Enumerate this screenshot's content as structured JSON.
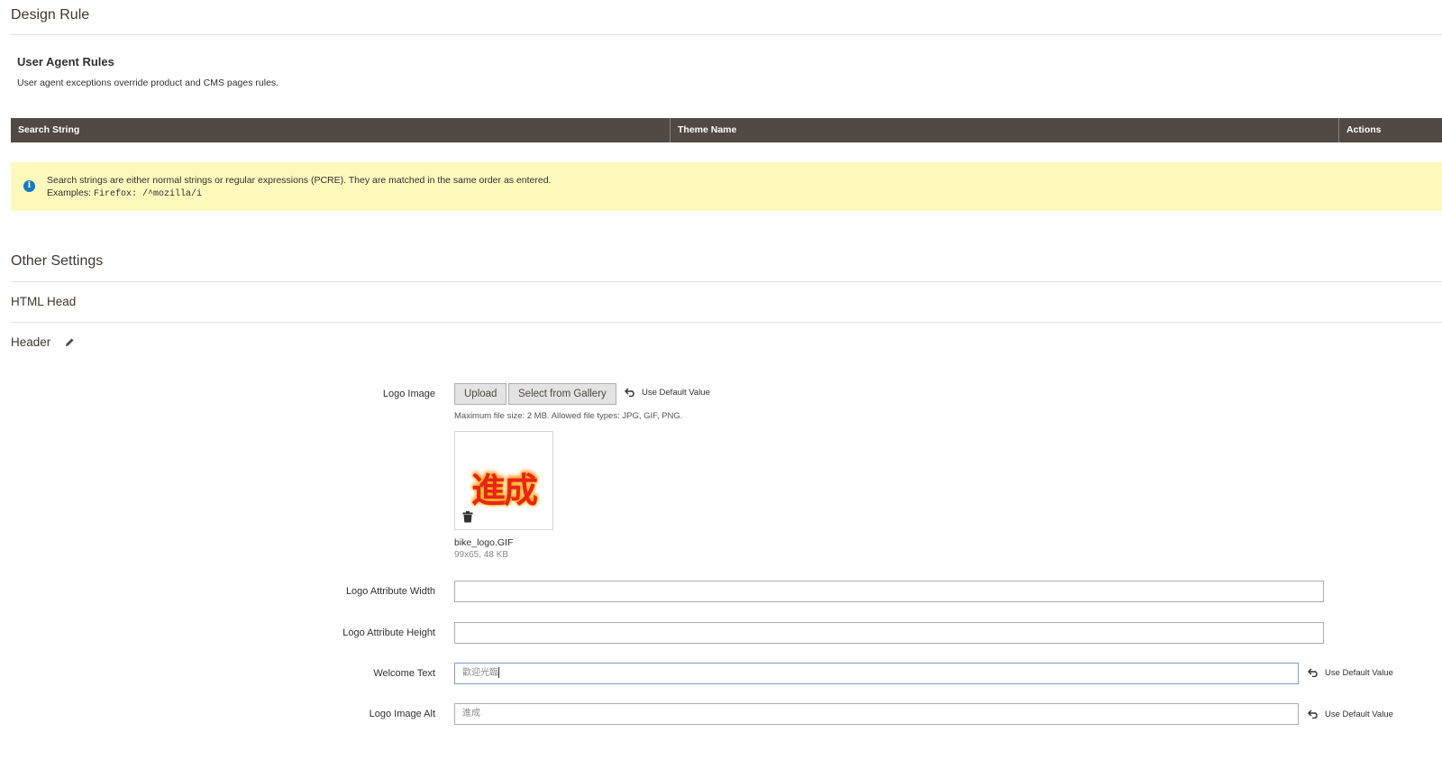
{
  "design_rule": {
    "title": "Design Rule"
  },
  "user_agent": {
    "title": "User Agent Rules",
    "description": "User agent exceptions override product and CMS pages rules.",
    "columns": [
      "Search String",
      "Theme Name",
      "Actions"
    ],
    "notice_line1": "Search strings are either normal strings or regular expressions (PCRE). They are matched in the same order as entered.",
    "notice_examples_label": "Examples:",
    "notice_examples_code": "Firefox: /^mozilla/i"
  },
  "other_settings": {
    "title": "Other Settings",
    "html_head": "HTML Head",
    "header": "Header"
  },
  "logo_image": {
    "label": "Logo Image",
    "upload": "Upload",
    "gallery": "Select from Gallery",
    "use_default": "Use Default Value",
    "note": "Maximum file size: 2 MB. Allowed file types: JPG, GIF, PNG.",
    "preview_text": "進成",
    "file_name": "bike_logo.GIF",
    "file_meta": "99x65, 48 KB"
  },
  "fields": {
    "width_label": "Logo Attribute Width",
    "width_value": "",
    "height_label": "Logo Attribute Height",
    "height_value": "",
    "welcome_label": "Welcome Text",
    "welcome_value": "歡迎光臨",
    "welcome_use_default": "Use Default Value",
    "alt_label": "Logo Image Alt",
    "alt_value": "進成",
    "alt_use_default": "Use Default Value"
  },
  "colors": {
    "grid_header": "#514943",
    "notice_bg": "#fdf9bd",
    "info_icon": "#1979c3",
    "logo_red": "#e8231b"
  }
}
